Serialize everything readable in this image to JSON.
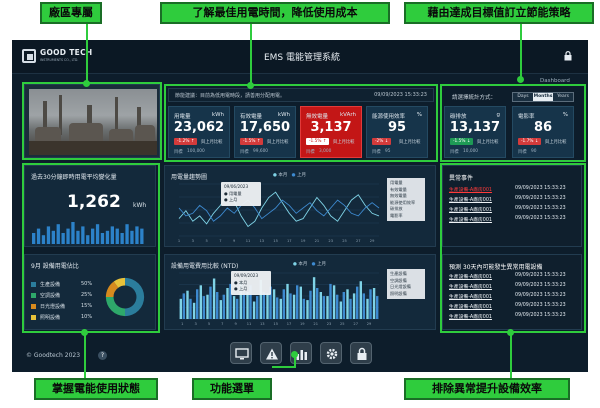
{
  "callouts": {
    "top_left": "廠區專屬",
    "top_center": "了解最佳用電時間，降低使用成本",
    "top_right": "藉由達成目標值訂立節能策略",
    "bottom_left": "掌握電能使用狀態",
    "bottom_center": "功能選單",
    "bottom_right": "排除異常提升設備效率"
  },
  "header": {
    "logo_name": "GOOD TECH",
    "logo_sub": "INSTRUMENTS CO., LTD.",
    "title": "EMS 電能管理系統",
    "lock_icon": "lock-icon"
  },
  "notice": {
    "text": "節能建議：目前為低用電時段，請善用分配用電。",
    "time": "09/09/2023 15:33:23"
  },
  "controls": {
    "label": "請選擇統計方式：",
    "dashboard_label": "Dashboard",
    "options": [
      "Days",
      "Months",
      "Years"
    ],
    "selected": "Months"
  },
  "kpis": [
    {
      "title": "用電量",
      "unit": "kWh",
      "value": "23,062",
      "badge": "-1.2% ↑",
      "compare": "與上月比較",
      "target_label": "目標",
      "target_value": "100,000",
      "alert": false,
      "trend": "up"
    },
    {
      "title": "有效電量",
      "unit": "kWh",
      "value": "17,650",
      "badge": "-1.5% ↑",
      "compare": "與上月比較",
      "target_label": "目標",
      "target_value": "99,600",
      "alert": false,
      "trend": "up"
    },
    {
      "title": "無效電量",
      "unit": "kVArh",
      "value": "3,137",
      "badge": "-1.5% ↑",
      "compare": "與上月比較",
      "target_label": "目標",
      "target_value": "3,000",
      "alert": true,
      "trend": "up"
    },
    {
      "title": "能源使用效率",
      "unit": "%",
      "value": "95",
      "badge": "-2% ↓",
      "compare": "與上月比較",
      "target_label": "目標",
      "target_value": "95",
      "alert": false,
      "trend": "up"
    },
    {
      "title": "碳排放",
      "unit": "g",
      "value": "13,137",
      "badge": "-1.5% ↓",
      "compare": "與上月比較",
      "target_label": "目標",
      "target_value": "10,000",
      "alert": false,
      "trend": "down"
    },
    {
      "title": "電影率",
      "unit": "%",
      "value": "86",
      "badge": "-1.7% ↓",
      "compare": "與上月比較",
      "target_label": "目標",
      "target_value": "90",
      "alert": false,
      "trend": "up"
    }
  ],
  "recent_usage": {
    "title": "過去30分鐘即時用電平均變化量",
    "value": "1,262",
    "unit": "kWh",
    "bars": [
      5,
      7,
      4,
      8,
      6,
      9,
      5,
      7,
      10,
      6,
      8,
      4,
      7,
      9,
      5,
      6,
      8,
      7,
      5,
      9,
      6,
      8,
      7,
      5
    ]
  },
  "distribution": {
    "title": "9月 設備用電佔比",
    "items": [
      {
        "name": "生產設備",
        "percent": "50%",
        "value": 50,
        "color": "#2b7d9c"
      },
      {
        "name": "空調設備",
        "percent": "25%",
        "value": 25,
        "color": "#2ea86a"
      },
      {
        "name": "日光燈設備",
        "percent": "15%",
        "value": 15,
        "color": "#d68a1e"
      },
      {
        "name": "照明設備",
        "percent": "10%",
        "value": 10,
        "color": "#e8c23a"
      }
    ]
  },
  "trend_chart": {
    "title": "用電量趨勢圖",
    "legend": [
      "本月",
      "上月"
    ],
    "tooltip": [
      "09/06/2023",
      "● 用電量",
      "● 上月"
    ],
    "menu": [
      "用電量",
      "有效電量",
      "無效電量",
      "能源使用效率",
      "碳排放",
      "電影率"
    ],
    "x_labels": [
      "1",
      "2",
      "3",
      "4",
      "5",
      "6",
      "7",
      "8",
      "9",
      "10",
      "11",
      "12",
      "13",
      "14",
      "15",
      "16",
      "17",
      "18",
      "19",
      "20",
      "21",
      "22",
      "23",
      "24",
      "25",
      "26",
      "27",
      "28",
      "29",
      "30"
    ],
    "series_a": [
      42,
      48,
      40,
      44,
      38,
      46,
      52,
      60,
      55,
      44,
      36,
      40,
      50,
      58,
      62,
      54,
      46,
      40,
      42,
      50,
      58,
      52,
      44,
      40,
      48,
      56,
      60,
      52,
      46,
      44
    ],
    "series_b": [
      50,
      44,
      46,
      52,
      48,
      40,
      44,
      50,
      46,
      52,
      56,
      50,
      42,
      46,
      50,
      56,
      52,
      46,
      50,
      54,
      48,
      44,
      50,
      56,
      52,
      46,
      44,
      50,
      54,
      50
    ]
  },
  "cost_chart": {
    "title": "設備用電費用比較 (NTD)",
    "legend": [
      "本月",
      "上月"
    ],
    "tooltip": [
      "09/09/2023",
      "● 本月",
      "● 上月"
    ],
    "menu": [
      "生產設備",
      "空調設備",
      "日光燈設備",
      "照明設備"
    ],
    "x_labels": [
      "1",
      "2",
      "3",
      "4",
      "5",
      "6",
      "7",
      "8",
      "9",
      "10",
      "11",
      "12",
      "13",
      "14",
      "15",
      "16",
      "17",
      "18",
      "19",
      "20",
      "21",
      "22",
      "23",
      "24",
      "25",
      "26",
      "27",
      "28",
      "29",
      "30"
    ],
    "series_a": [
      30,
      42,
      24,
      50,
      36,
      60,
      28,
      46,
      34,
      55,
      40,
      26,
      58,
      38,
      44,
      30,
      52,
      36,
      48,
      28,
      62,
      40,
      34,
      50,
      26,
      44,
      38,
      56,
      30,
      46
    ],
    "series_b": [
      38,
      30,
      44,
      34,
      48,
      40,
      36,
      52,
      30,
      42,
      50,
      34,
      40,
      48,
      32,
      44,
      38,
      50,
      30,
      42,
      46,
      34,
      52,
      36,
      40,
      30,
      48,
      38,
      44,
      34
    ]
  },
  "events": {
    "title": "異常事件",
    "rows": [
      {
        "name": "生產設備-A廠房001",
        "time": "09/09/2023 15:33:23",
        "red": true
      },
      {
        "name": "生產設備-A廠房001",
        "time": "09/09/2023 15:33:23",
        "red": false
      },
      {
        "name": "生產設備-A廠房001",
        "time": "09/09/2023 15:33:23",
        "red": false
      },
      {
        "name": "生產設備-A廠房001",
        "time": "09/09/2023 15:33:23",
        "red": false
      }
    ]
  },
  "predictions": {
    "title": "預測 30天內可能發生異常用電設備",
    "rows": [
      {
        "name": "生產設備-A廠房001",
        "time": "09/09/2023 15:33:23"
      },
      {
        "name": "生產設備-A廠房001",
        "time": "09/09/2023 15:33:23"
      },
      {
        "name": "生產設備-A廠房001",
        "time": "09/09/2023 15:33:23"
      },
      {
        "name": "生產設備-A廠房001",
        "time": "09/09/2023 15:33:23"
      },
      {
        "name": "生產設備-A廠房001",
        "time": "09/09/2023 15:33:23"
      }
    ]
  },
  "footer": {
    "copyright": "© Goodtech 2023",
    "help": "?"
  },
  "menu_bar": {
    "icons": [
      "monitor-icon",
      "warning-icon",
      "bar-chart-icon",
      "gear-icon",
      "lock-icon"
    ]
  }
}
